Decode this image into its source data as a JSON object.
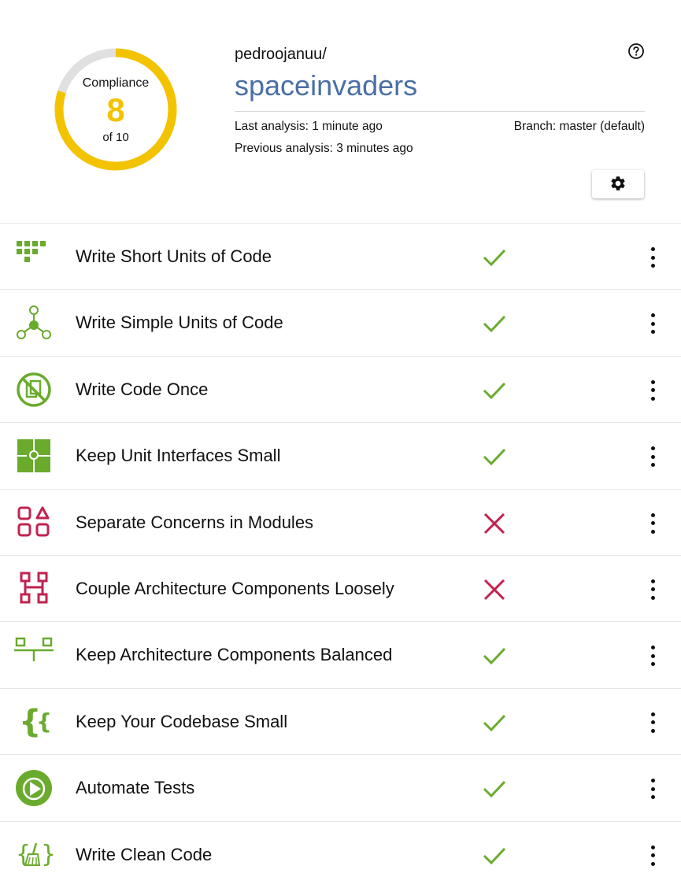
{
  "compliance": {
    "label": "Compliance",
    "score": "8",
    "total_label": "of 10",
    "score_value": 8,
    "max_value": 10
  },
  "repo": {
    "owner": "pedroojanuu/",
    "name": "spaceinvaders",
    "last_analysis": "Last analysis: 1 minute ago",
    "previous_analysis": "Previous analysis: 3 minutes ago",
    "branch": "Branch: master (default)"
  },
  "icons": {
    "help": "help-circle-icon",
    "settings": "gear-icon"
  },
  "colors": {
    "pass": "#6aab2e",
    "fail": "#c0234f",
    "gauge": "#f3c300",
    "gauge_track": "#e0e0e0",
    "repo_name": "#4a6fa5"
  },
  "guidelines": [
    {
      "label": "Write Short Units of Code",
      "status": "pass",
      "icon": "short-units-icon",
      "icon_color": "#6aab2e"
    },
    {
      "label": "Write Simple Units of Code",
      "status": "pass",
      "icon": "simple-units-icon",
      "icon_color": "#6aab2e"
    },
    {
      "label": "Write Code Once",
      "status": "pass",
      "icon": "no-duplication-icon",
      "icon_color": "#6aab2e"
    },
    {
      "label": "Keep Unit Interfaces Small",
      "status": "pass",
      "icon": "puzzle-icon",
      "icon_color": "#6aab2e"
    },
    {
      "label": "Separate Concerns in Modules",
      "status": "fail",
      "icon": "modules-icon",
      "icon_color": "#c0234f"
    },
    {
      "label": "Couple Architecture Components Loosely",
      "status": "fail",
      "icon": "components-icon",
      "icon_color": "#c0234f"
    },
    {
      "label": "Keep Architecture Components Balanced",
      "status": "pass",
      "icon": "balance-icon",
      "icon_color": "#6aab2e"
    },
    {
      "label": "Keep Your Codebase Small",
      "status": "pass",
      "icon": "braces-icon",
      "icon_color": "#6aab2e"
    },
    {
      "label": "Automate Tests",
      "status": "pass",
      "icon": "play-circle-icon",
      "icon_color": "#6aab2e"
    },
    {
      "label": "Write Clean Code",
      "status": "pass",
      "icon": "broom-braces-icon",
      "icon_color": "#6aab2e"
    }
  ]
}
